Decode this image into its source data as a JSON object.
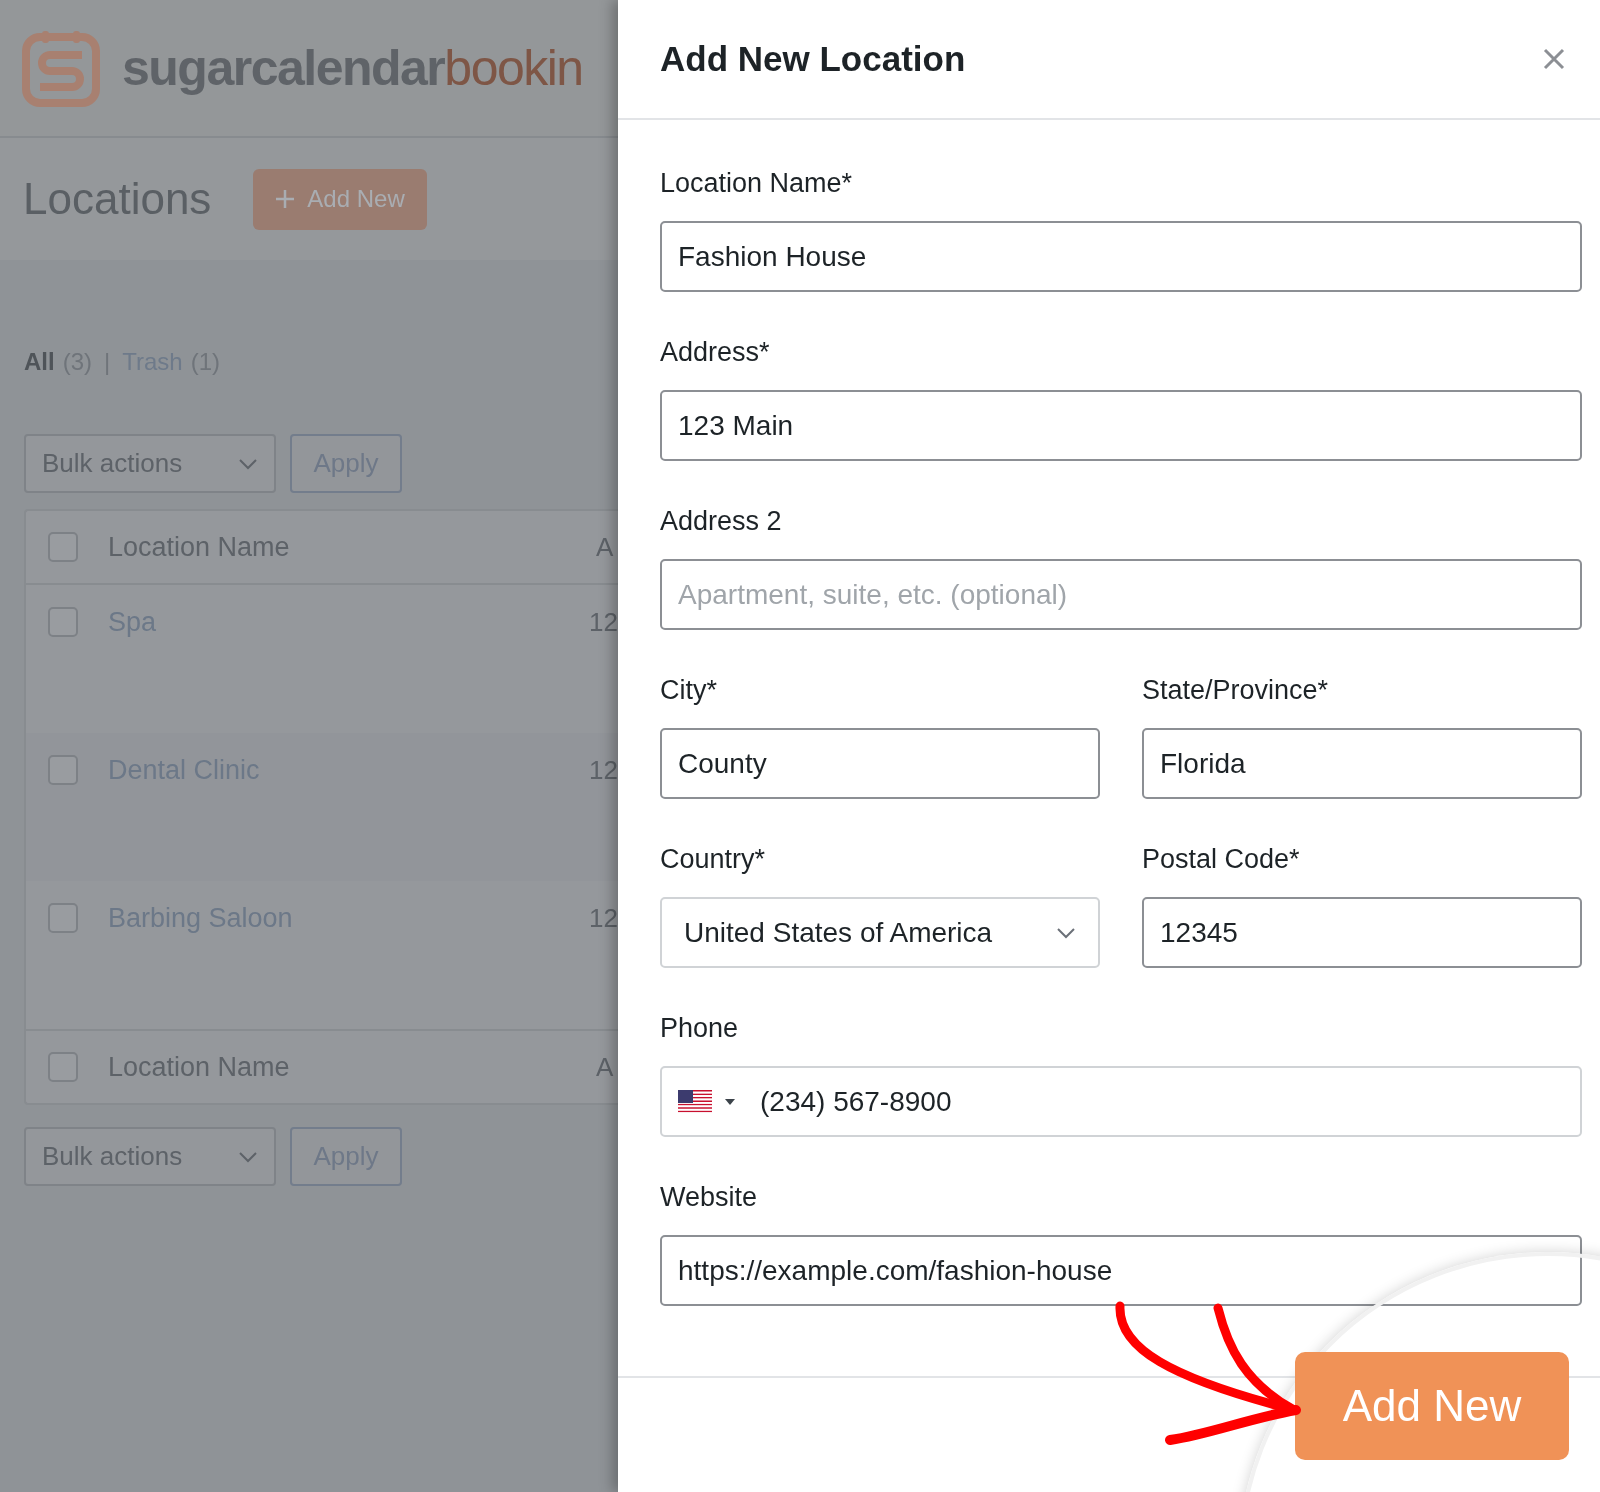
{
  "background": {
    "logo": {
      "primary": "sugarcalendar",
      "accent": "bookin"
    },
    "page_title": "Locations",
    "add_button": "Add New",
    "views": [
      {
        "label": "All",
        "count": "(3)",
        "selected": true
      },
      {
        "label": "Trash",
        "count": "(1)",
        "selected": false
      }
    ],
    "view_separator": "|",
    "bulk_top": {
      "value": "Bulk actions",
      "apply": "Apply"
    },
    "table": {
      "columns": [
        {
          "label": "Location Name",
          "checked": false
        },
        {
          "label": "A"
        }
      ],
      "rows": [
        {
          "name": "Spa",
          "column_2": "12",
          "checked": false
        },
        {
          "name": "Dental Clinic",
          "column_2": "12",
          "checked": false
        },
        {
          "name": "Barbing Saloon",
          "column_2": "12",
          "checked": false
        }
      ],
      "footer_columns": [
        {
          "label": "Location Name",
          "checked": false
        },
        {
          "label": "A"
        }
      ]
    },
    "bulk_bottom": {
      "value": "Bulk actions",
      "apply": "Apply"
    }
  },
  "drawer": {
    "title": "Add New Location",
    "rows": [
      [
        {
          "kind": "text",
          "label": "Location Name*",
          "value": "Fashion House"
        }
      ],
      [
        {
          "kind": "text",
          "label": "Address*",
          "value": "123 Main"
        }
      ],
      [
        {
          "kind": "text",
          "label": "Address 2",
          "placeholder": "Apartment, suite, etc. (optional)"
        }
      ],
      [
        {
          "kind": "text",
          "label": "City*",
          "value": "County"
        },
        {
          "kind": "text",
          "label": "State/Province*",
          "value": "Florida"
        }
      ],
      [
        {
          "kind": "select",
          "label": "Country*",
          "value": "United States of America"
        },
        {
          "kind": "text",
          "label": "Postal Code*",
          "value": "12345"
        }
      ],
      [
        {
          "kind": "phone",
          "label": "Phone",
          "value": "(234) 567-8900"
        }
      ],
      [
        {
          "kind": "text",
          "label": "Website",
          "value": "https://example.com/fashion-house"
        }
      ]
    ],
    "submit": "Add New"
  }
}
